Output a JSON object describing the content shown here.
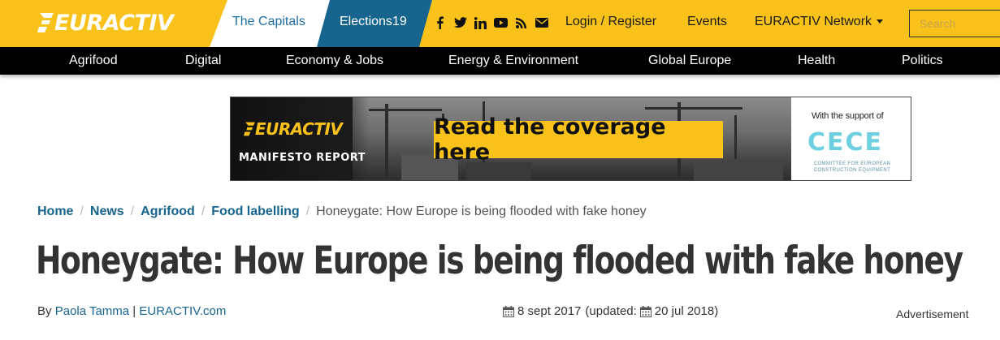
{
  "header": {
    "logo_text": "EURACTIV",
    "tabs": [
      {
        "label": "The Capitals"
      },
      {
        "label": "Elections19"
      }
    ],
    "social_icons": [
      "facebook-icon",
      "twitter-icon",
      "linkedin-icon",
      "youtube-icon",
      "rss-icon",
      "envelope-icon"
    ],
    "links": {
      "login": "Login / Register",
      "events": "Events",
      "network": "EURACTIV Network"
    },
    "search": {
      "placeholder": "Search",
      "value": ""
    },
    "colors": {
      "brand_yellow": "#f8c21b",
      "brand_blue": "#17658f",
      "nav_black": "#000000"
    }
  },
  "nav": {
    "items": [
      {
        "label": "Agrifood"
      },
      {
        "label": "Digital"
      },
      {
        "label": "Economy & Jobs"
      },
      {
        "label": "Energy & Environment"
      },
      {
        "label": "Global Europe"
      },
      {
        "label": "Health"
      },
      {
        "label": "Politics"
      }
    ]
  },
  "banner": {
    "logo_text": "EURACTIV",
    "report_label": "MANIFESTO REPORT",
    "cta": "Read the coverage here",
    "support_text": "With the support of",
    "sponsor_logo": "CECE",
    "sponsor_name": "COMMITTEE FOR EUROPEAN CONSTRUCTION EQUIPMENT"
  },
  "breadcrumb": {
    "items": [
      {
        "label": "Home"
      },
      {
        "label": "News"
      },
      {
        "label": "Agrifood"
      },
      {
        "label": "Food labelling"
      }
    ],
    "current": "Honeygate: How Europe is being flooded with fake honey"
  },
  "article": {
    "title": "Honeygate: How Europe is being flooded with fake honey",
    "by_label": "By",
    "author": "Paola Tamma",
    "separator": "|",
    "outlet": "EURACTIV.com",
    "published": "8 sept 2017",
    "updated_prefix": "(updated:",
    "updated": "20 jul 2018)"
  },
  "sidebar": {
    "advert_label": "Advertisement"
  }
}
